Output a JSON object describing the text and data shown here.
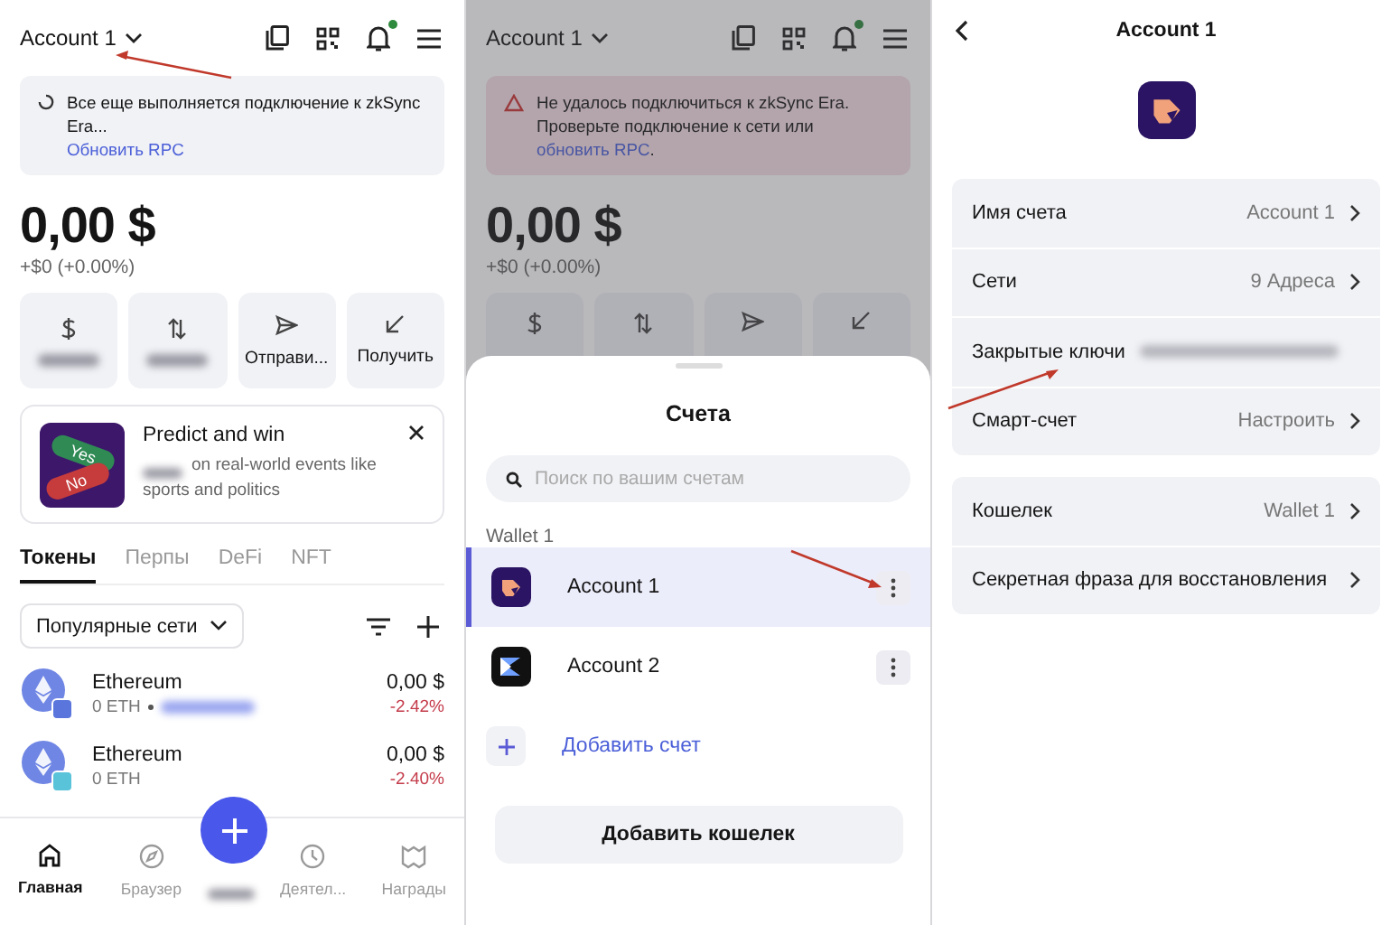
{
  "home_screen": {
    "header": {
      "account": "Account 1",
      "notification_dot": true
    },
    "notice": {
      "kind": "loading",
      "text": "Все еще выполняется подключение к zkSync Era...",
      "link": "Обновить RPC"
    },
    "balance": "0,00 $",
    "change": "+$0 (+0.00%)",
    "actions": [
      {
        "kind": "blurred"
      },
      {
        "kind": "blurred"
      },
      {
        "kind": "labeled",
        "label": "Отправи..."
      },
      {
        "kind": "labeled",
        "label": "Получить"
      }
    ],
    "promo": {
      "title": "Predict and win",
      "text_prefix_blurred": true,
      "text": "on real-world events like sports and politics",
      "image_labels": [
        "Yes",
        "No"
      ]
    },
    "tabs": [
      {
        "label": "Токены",
        "selected": true
      },
      {
        "label": "Перпы",
        "selected": false
      },
      {
        "label": "DeFi",
        "selected": false
      },
      {
        "label": "NFT",
        "selected": false
      }
    ],
    "network_filter": "Популярные сети",
    "tokens": [
      {
        "name": "Ethereum",
        "amount": "0 ETH",
        "earn_blurred": true,
        "value": "0,00 $",
        "change": "-2.42%"
      },
      {
        "name": "Ethereum",
        "amount": "0 ETH",
        "earn_blurred": false,
        "value": "0,00 $",
        "change": "-2.40%"
      }
    ],
    "nav": [
      {
        "kind": "tab",
        "label": "Главная",
        "selected": true
      },
      {
        "kind": "tab",
        "label": "Браузер",
        "selected": false
      },
      {
        "kind": "blurred"
      },
      {
        "kind": "tab",
        "label": "Деятел...",
        "selected": false
      },
      {
        "kind": "tab",
        "label": "Награды",
        "selected": false
      }
    ]
  },
  "accounts_screen": {
    "header": {
      "account": "Account 1",
      "notification_dot": true
    },
    "notice": {
      "kind": "error",
      "text": "Не удалось подключиться к zkSync Era. Проверьте подключение к сети или",
      "link": "обновить RPC",
      "after_link": "."
    },
    "balance": "0,00 $",
    "change": "+$0 (+0.00%)",
    "sheet": {
      "title": "Счета",
      "search": {
        "placeholder": "Поиск по вашим счетам"
      },
      "group": "Wallet 1",
      "accounts": [
        {
          "name": "Account 1",
          "selected": true
        },
        {
          "name": "Account 2",
          "selected": false
        }
      ],
      "add_account": "Добавить счет",
      "add_wallet": "Добавить кошелек"
    }
  },
  "account_screen": {
    "title": "Account 1",
    "groups": [
      {
        "rows": [
          {
            "label": "Имя счета",
            "value": "Account 1",
            "kind": "value"
          },
          {
            "label": "Сети",
            "value": "9 Адреса",
            "kind": "value"
          },
          {
            "label": "Закрытые ключи",
            "kind": "hidden"
          },
          {
            "label": "Смарт-счет",
            "value": "Настроить",
            "kind": "value"
          }
        ]
      },
      {
        "rows": [
          {
            "label": "Кошелек",
            "value": "Wallet 1",
            "kind": "value"
          },
          {
            "label": "Секретная фраза для восстановления",
            "kind": "plain"
          }
        ]
      }
    ]
  }
}
